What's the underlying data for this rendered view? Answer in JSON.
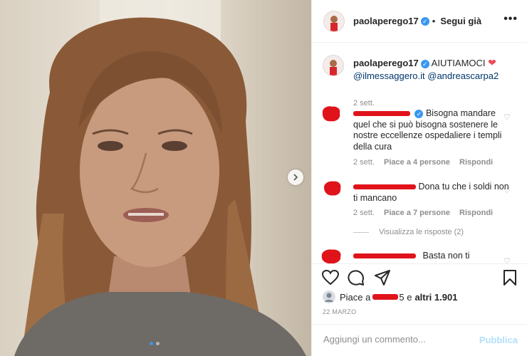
{
  "post": {
    "username": "paolaperego17",
    "follow_label": "Segui già",
    "more_icon": "more-icon"
  },
  "caption": {
    "username": "paolaperego17",
    "text": "AIUTIAMOCI",
    "mention1": "@ilmessaggero.it",
    "mention2": "@andreascarpa2",
    "time": "2 sett."
  },
  "comments": [
    {
      "text_line1": "Bisogna",
      "text_rest": "mandare quel che si può bisogna sostenere le nostre eccellenze ospedaliere i templi della cura",
      "time": "2 sett.",
      "likes": "Piace a 4 persone",
      "reply": "Rispondi"
    },
    {
      "text_line1": "Dona tu che i soldi",
      "text_rest": "non ti mancano",
      "time": "2 sett.",
      "likes": "Piace a 7 persone",
      "reply": "Rispondi",
      "view_replies": "Visualizza le risposte (2)"
    },
    {
      "text_line1": "Basta non ti"
    }
  ],
  "likes": {
    "prefix": "Piace a",
    "suffix": "5 e",
    "others": "altri 1.901"
  },
  "date": "22 MARZO",
  "add_comment": {
    "placeholder": "Aggiungi un commento...",
    "publish_label": "Pubblica"
  },
  "colors": {
    "link": "#00376b",
    "verified": "#3897f0",
    "redaction": "#e0131b",
    "publish_disabled": "#b2dffc"
  }
}
